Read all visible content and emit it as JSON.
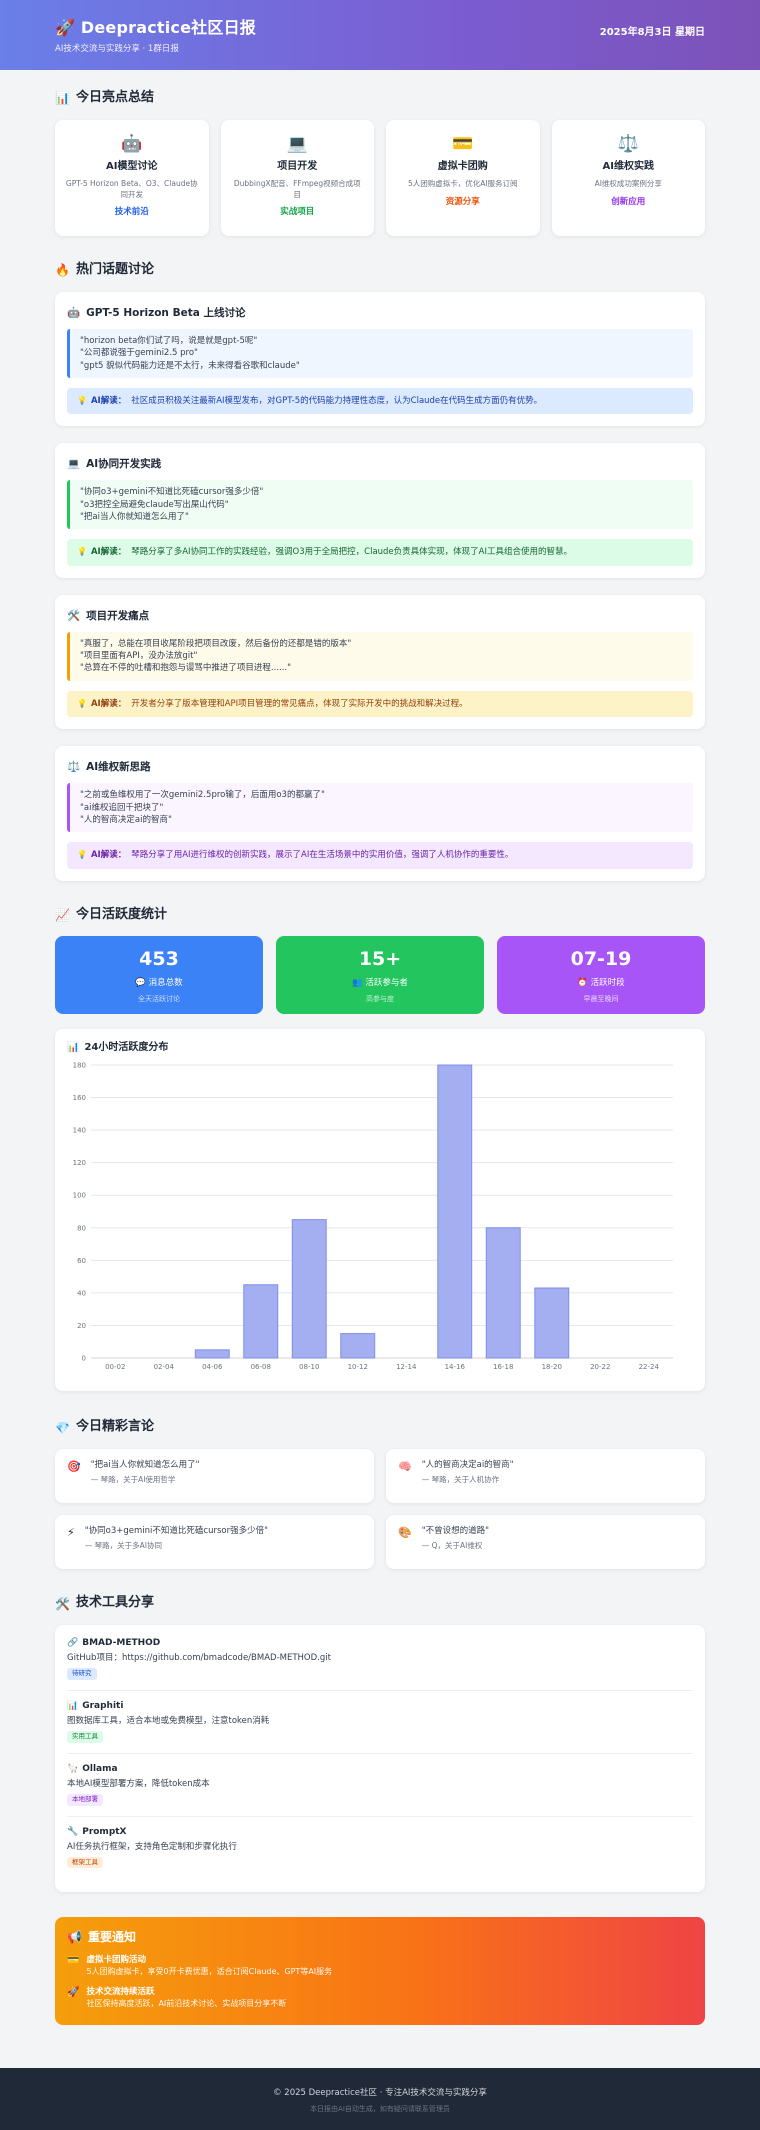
{
  "header": {
    "title": "🚀 Deepractice社区日报",
    "subtitle": "AI技术交流与实践分享 · 1群日报",
    "date": "2025年8月3日 星期日"
  },
  "highlights": {
    "title": "今日亮点总结",
    "icon": "📊",
    "cards": [
      {
        "icon": "🤖",
        "title": "AI模型讨论",
        "desc": "GPT-5 Horizon Beta、O3、Claude协同开发",
        "tag": "技术前沿",
        "color": "#2563eb"
      },
      {
        "icon": "💻",
        "title": "项目开发",
        "desc": "DubbingX配音、FFmpeg视频合成项目",
        "tag": "实战项目",
        "color": "#16a34a"
      },
      {
        "icon": "💳",
        "title": "虚拟卡团购",
        "desc": "5人团购虚拟卡，优化AI服务订阅",
        "tag": "资源分享",
        "color": "#ea580c"
      },
      {
        "icon": "⚖️",
        "title": "AI维权实践",
        "desc": "AI维权成功案例分享",
        "tag": "创新应用",
        "color": "#9333ea"
      }
    ]
  },
  "topics": {
    "title": "热门话题讨论",
    "icon": "🔥",
    "items": [
      {
        "icon": "🤖",
        "title": "GPT-5 Horizon Beta 上线讨论",
        "quotes": [
          "\"horizon beta你们试了吗，说是就是gpt-5呢\"",
          "\"公司都说强于gemini2.5 pro\"",
          "\"gpt5 貌似代码能力还是不太行，未来得看谷歌和claude\""
        ],
        "interp_label": "AI解读：",
        "interp": "社区成员积极关注最新AI模型发布，对GPT-5的代码能力持理性态度，认为Claude在代码生成方面仍有优势。",
        "border": "#3b82f6",
        "qbg": "#eff6ff",
        "ibg": "#dbeafe",
        "itext": "#1e40af"
      },
      {
        "icon": "💻",
        "title": "AI协同开发实践",
        "quotes": [
          "\"协同o3+gemini不知道比死磕cursor强多少倍\"",
          "\"o3把控全局避免claude写出屎山代码\"",
          "\"把ai当人你就知道怎么用了\""
        ],
        "interp_label": "AI解读：",
        "interp": "琴路分享了多AI协同工作的实践经验，强调O3用于全局把控，Claude负责具体实现，体现了AI工具组合使用的智慧。",
        "border": "#22c55e",
        "qbg": "#f0fdf4",
        "ibg": "#dcfce7",
        "itext": "#166534"
      },
      {
        "icon": "🛠️",
        "title": "项目开发痛点",
        "quotes": [
          "\"真服了，总能在项目收尾阶段把项目改废，然后备份的还都是错的版本\"",
          "\"项目里面有API，没办法放git\"",
          "\"总算在不停的吐槽和抱怨与谩骂中推进了项目进程......\""
        ],
        "interp_label": "AI解读：",
        "interp": "开发者分享了版本管理和API项目管理的常见痛点，体现了实际开发中的挑战和解决过程。",
        "border": "#f59e0b",
        "qbg": "#fffbeb",
        "ibg": "#fef3c7",
        "itext": "#92400e"
      },
      {
        "icon": "⚖️",
        "title": "AI维权新思路",
        "quotes": [
          "\"之前或鱼维权用了一次gemini2.5pro输了，后面用o3的都赢了\"",
          "\"ai维权追回千把块了\"",
          "\"人的智商决定ai的智商\""
        ],
        "interp_label": "AI解读：",
        "interp": "琴路分享了用AI进行维权的创新实践，展示了AI在生活场景中的实用价值，强调了人机协作的重要性。",
        "border": "#a855f7",
        "qbg": "#faf5ff",
        "ibg": "#f3e8ff",
        "itext": "#6b21a8"
      }
    ]
  },
  "stats": {
    "title": "今日活跃度统计",
    "icon": "📈",
    "cards": [
      {
        "value": "453",
        "label": "💬 消息总数",
        "sub": "全天活跃讨论",
        "bg": "#3b82f6"
      },
      {
        "value": "15+",
        "label": "👥 活跃参与者",
        "sub": "高参与度",
        "bg": "#22c55e"
      },
      {
        "value": "07-19",
        "label": "⏰ 活跃时段",
        "sub": "早晨至晚间",
        "bg": "#a855f7"
      }
    ]
  },
  "chart_title": "24小时活跃度分布",
  "chart_icon": "📊",
  "chart_data": {
    "type": "bar",
    "title": "24小时活跃度分布",
    "categories": [
      "00-02",
      "02-04",
      "04-06",
      "06-08",
      "08-10",
      "10-12",
      "12-14",
      "14-16",
      "16-18",
      "18-20",
      "20-22",
      "22-24"
    ],
    "values": [
      0,
      0,
      5,
      45,
      85,
      15,
      0,
      180,
      80,
      43,
      0,
      0
    ],
    "ylim": [
      0,
      180
    ],
    "yticks": [
      0,
      20,
      40,
      60,
      80,
      100,
      120,
      140,
      160,
      180
    ],
    "grid": true,
    "bar_color": "#a3aff0",
    "bar_edge": "#7f8fe6"
  },
  "quotes_section": {
    "title": "今日精彩言论",
    "icon": "💎",
    "items": [
      {
        "icon": "🎯",
        "text": "\"把ai当人你就知道怎么用了\"",
        "meta": "— 琴路，关于AI使用哲学"
      },
      {
        "icon": "🧠",
        "text": "\"人的智商决定ai的智商\"",
        "meta": "— 琴路，关于人机协作"
      },
      {
        "icon": "⚡",
        "text": "\"协同o3+gemini不知道比死磕cursor强多少倍\"",
        "meta": "— 琴路，关于多AI协同"
      },
      {
        "icon": "🎨",
        "text": "\"不曾设想的道路\"",
        "meta": "— Q，关于AI维权"
      }
    ]
  },
  "tools": {
    "title": "技术工具分享",
    "icon": "🛠️",
    "items": [
      {
        "icon": "🔗",
        "name": "BMAD-METHOD",
        "desc": "GitHub项目：https://github.com/bmadcode/BMAD-METHOD.git",
        "badge": "待研究",
        "bbg": "#dbeafe",
        "bcol": "#1d4ed8"
      },
      {
        "icon": "📊",
        "name": "Graphiti",
        "desc": "图数据库工具，适合本地或免费模型，注意token消耗",
        "badge": "实用工具",
        "bbg": "#dcfce7",
        "bcol": "#15803d"
      },
      {
        "icon": "🦙",
        "name": "Ollama",
        "desc": "本地AI模型部署方案，降低token成本",
        "badge": "本地部署",
        "bbg": "#f3e8ff",
        "bcol": "#7e22ce"
      },
      {
        "icon": "🔧",
        "name": "PromptX",
        "desc": "AI任务执行框架，支持角色定制和步骤化执行",
        "badge": "框架工具",
        "bbg": "#ffedd5",
        "bcol": "#c2410c"
      }
    ]
  },
  "notice": {
    "title": "重要通知",
    "icon": "📢",
    "items": [
      {
        "icon": "💳",
        "head": "虚拟卡团购活动",
        "desc": "5人团购虚拟卡，享受0开卡费优惠，适合订阅Claude、GPT等AI服务"
      },
      {
        "icon": "🚀",
        "head": "技术交流持续活跃",
        "desc": "社区保持高度活跃，AI前沿技术讨论、实战项目分享不断"
      }
    ]
  },
  "footer": {
    "line1": "© 2025 Deepractice社区 · 专注AI技术交流与实践分享",
    "line2": "本日报由AI自动生成，如有疑问请联系管理员"
  }
}
